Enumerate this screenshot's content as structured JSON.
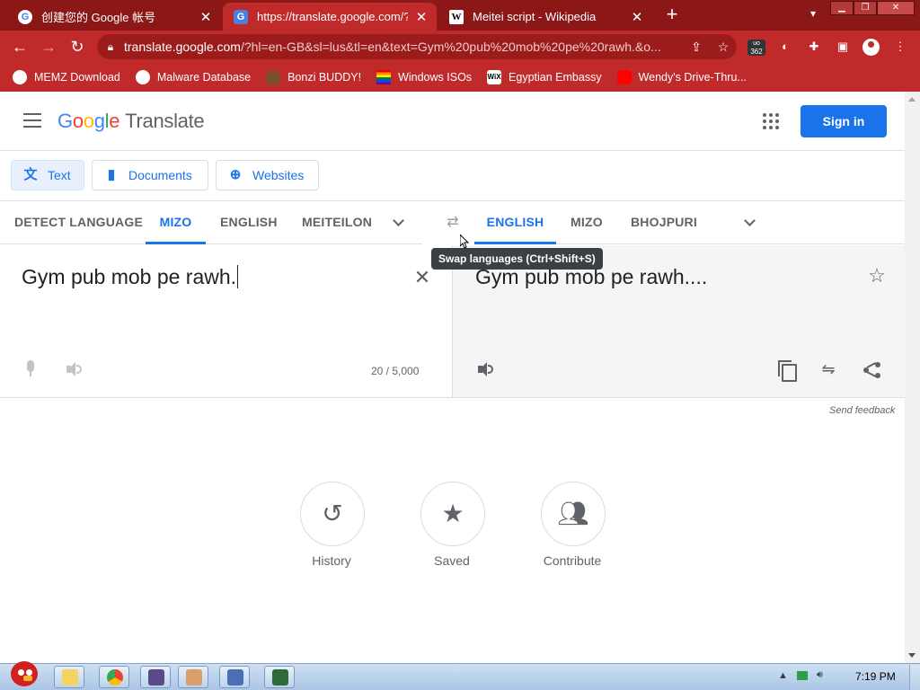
{
  "browser": {
    "tabs": [
      {
        "title": "创建您的 Google 帐号",
        "icon": "google-g-icon"
      },
      {
        "title": "https://translate.google.com/?hl=",
        "icon": "google-translate-icon"
      },
      {
        "title": "Meitei script - Wikipedia",
        "icon": "wikipedia-icon"
      }
    ],
    "new_tab": "+",
    "url_host": "translate.google.com",
    "url_rest": "/?hl=en-GB&sl=lus&tl=en&text=Gym%20pub%20mob%20pe%20rawh.&o...",
    "ext_badge": "362",
    "accent": "#c12a2a",
    "dark_accent": "#8b1717"
  },
  "bookmarks": [
    {
      "label": "MEMZ Download",
      "color": "#ffffff"
    },
    {
      "label": "Malware Database",
      "color": "#ffffff"
    },
    {
      "label": "Bonzi BUDDY!",
      "color": "#6b3fa0"
    },
    {
      "label": "Windows ISOs",
      "color": "#e4572e"
    },
    {
      "label": "Egyptian Embassy",
      "color": "#ffffff"
    },
    {
      "label": "Wendy's Drive-Thru...",
      "color": "#ff0000"
    }
  ],
  "header": {
    "logo_letters": [
      {
        "ch": "G",
        "color": "#4285f4"
      },
      {
        "ch": "o",
        "color": "#ea4335"
      },
      {
        "ch": "o",
        "color": "#fbbc05"
      },
      {
        "ch": "g",
        "color": "#4285f4"
      },
      {
        "ch": "l",
        "color": "#34a853"
      },
      {
        "ch": "e",
        "color": "#ea4335"
      }
    ],
    "product": "Translate",
    "sign_in": "Sign in"
  },
  "modes": {
    "text": "Text",
    "documents": "Documents",
    "websites": "Websites"
  },
  "source_langs": {
    "detect": "DETECT LANGUAGE",
    "l1": "MIZO",
    "l2": "ENGLISH",
    "l3": "MEITEILON (",
    "selected": "MIZO"
  },
  "target_langs": {
    "l1": "ENGLISH",
    "l2": "MIZO",
    "l3": "BHOJPURI",
    "selected": "ENGLISH"
  },
  "swap_tooltip": "Swap languages (Ctrl+Shift+S)",
  "source": {
    "text": "Gym pub mob pe rawh.",
    "counter": "20 / 5,000"
  },
  "target": {
    "text": "Gym pub mob pe rawh...."
  },
  "send_feedback": "Send feedback",
  "bottom_actions": {
    "history": "History",
    "saved": "Saved",
    "contribute": "Contribute"
  },
  "taskbar": {
    "clock": "7:19 PM"
  }
}
